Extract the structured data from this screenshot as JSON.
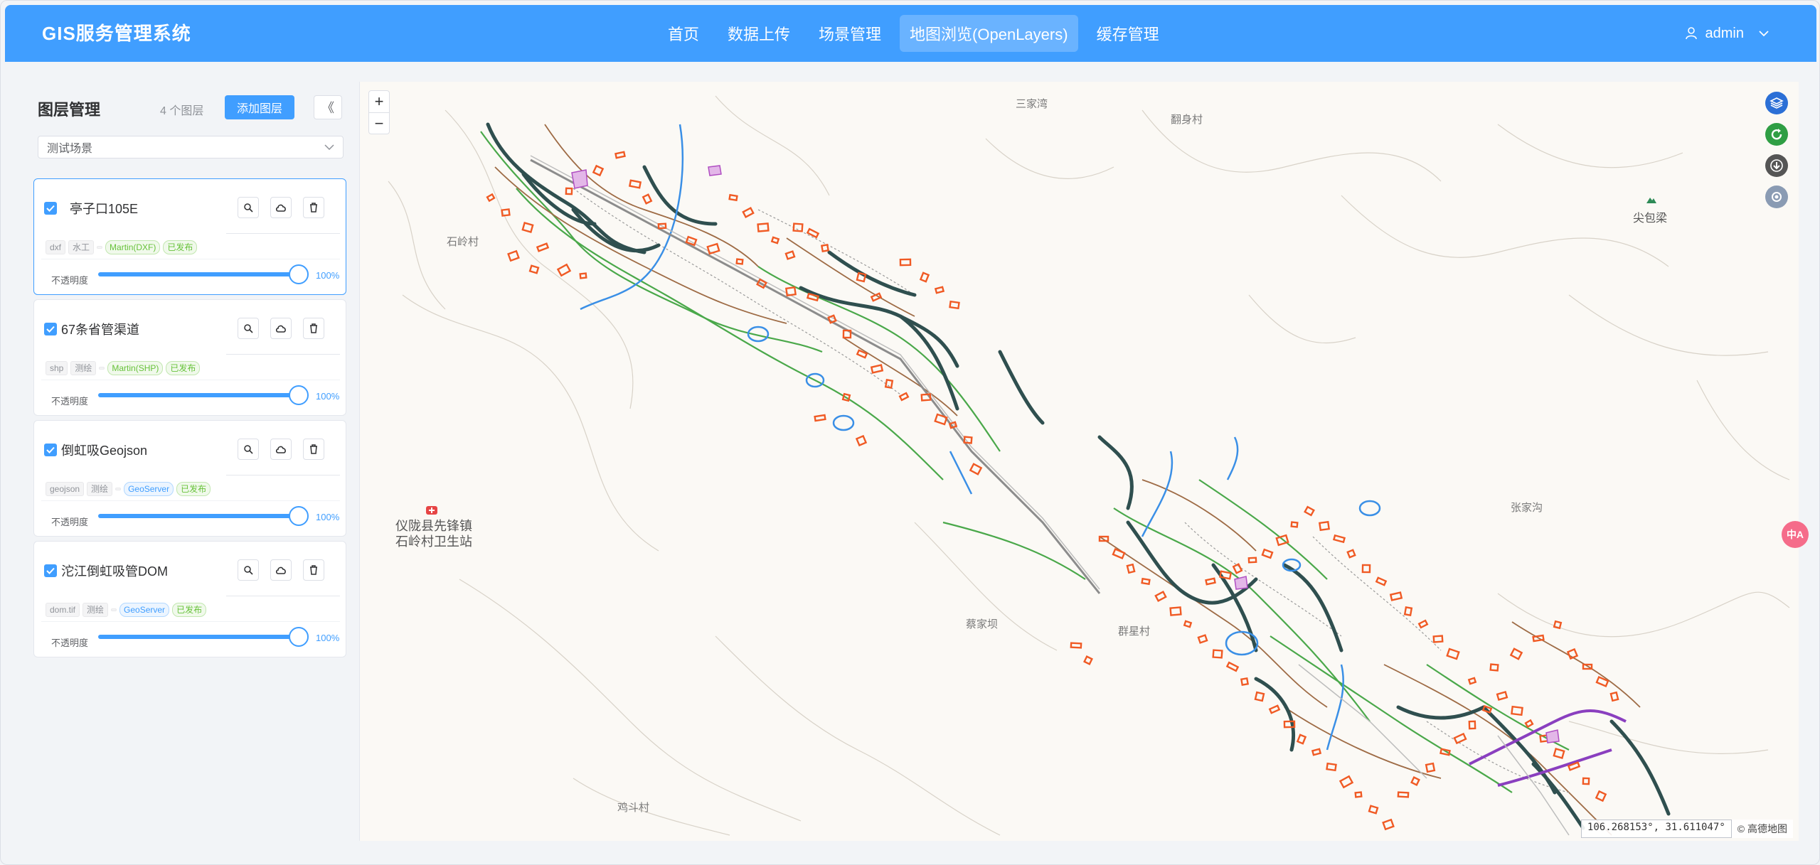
{
  "app": {
    "title": "GIS服务管理系统"
  },
  "nav": [
    {
      "label": "首页",
      "active": false
    },
    {
      "label": "数据上传",
      "active": false
    },
    {
      "label": "场景管理",
      "active": false
    },
    {
      "label": "地图浏览(OpenLayers)",
      "active": true
    },
    {
      "label": "缓存管理",
      "active": false
    }
  ],
  "user": {
    "name": "admin"
  },
  "sidebar": {
    "title": "图层管理",
    "count_text": "4 个图层",
    "add_label": "添加图层",
    "collapse_glyph": "《",
    "scene_value": "测试场景"
  },
  "layers": [
    {
      "name": "亭子口105E",
      "checked": true,
      "selected": true,
      "tags": [
        "dxf",
        "水工",
        "",
        "Martin(DXF)",
        "已发布"
      ],
      "opacity_label": "不透明度",
      "opacity_text": "100%",
      "opacity": 1.0
    },
    {
      "name": "67条省管渠道",
      "checked": true,
      "selected": false,
      "tags": [
        "shp",
        "测绘",
        "",
        "Martin(SHP)",
        "已发布"
      ],
      "opacity_label": "不透明度",
      "opacity_text": "100%",
      "opacity": 1.0
    },
    {
      "name": "倒虹吸Geojson",
      "checked": true,
      "selected": false,
      "tags": [
        "geojson",
        "测绘",
        "",
        "GeoServer",
        "已发布"
      ],
      "opacity_label": "不透明度",
      "opacity_text": "100%",
      "opacity": 1.0
    },
    {
      "name": "沱江倒虹吸管DOM",
      "checked": true,
      "selected": false,
      "tags": [
        "dom.tif",
        "测绘",
        "",
        "GeoServer",
        "已发布"
      ],
      "opacity_label": "不透明度",
      "opacity_text": "100%",
      "opacity": 1.0
    }
  ],
  "map": {
    "zoom_in": "+",
    "zoom_out": "−",
    "places": [
      "三家湾",
      "翻身村",
      "石岭村",
      "尖包梁",
      "张家沟",
      "蔡家坝",
      "群星村",
      "鸡斗村"
    ],
    "poi": [
      "仪陇县先锋镇",
      "石岭村卫生站"
    ],
    "coordinates": "106.268153°, 31.611047°",
    "attribution": "© 高德地图",
    "colors": {
      "road": "#2f4f4f",
      "building": "#f05a24",
      "contour": "#9e6b45",
      "vegetation": "#4aa84a",
      "water": "#3a8fe6",
      "purple": "#8a3fbf"
    }
  },
  "floating": {
    "label": "中A"
  }
}
